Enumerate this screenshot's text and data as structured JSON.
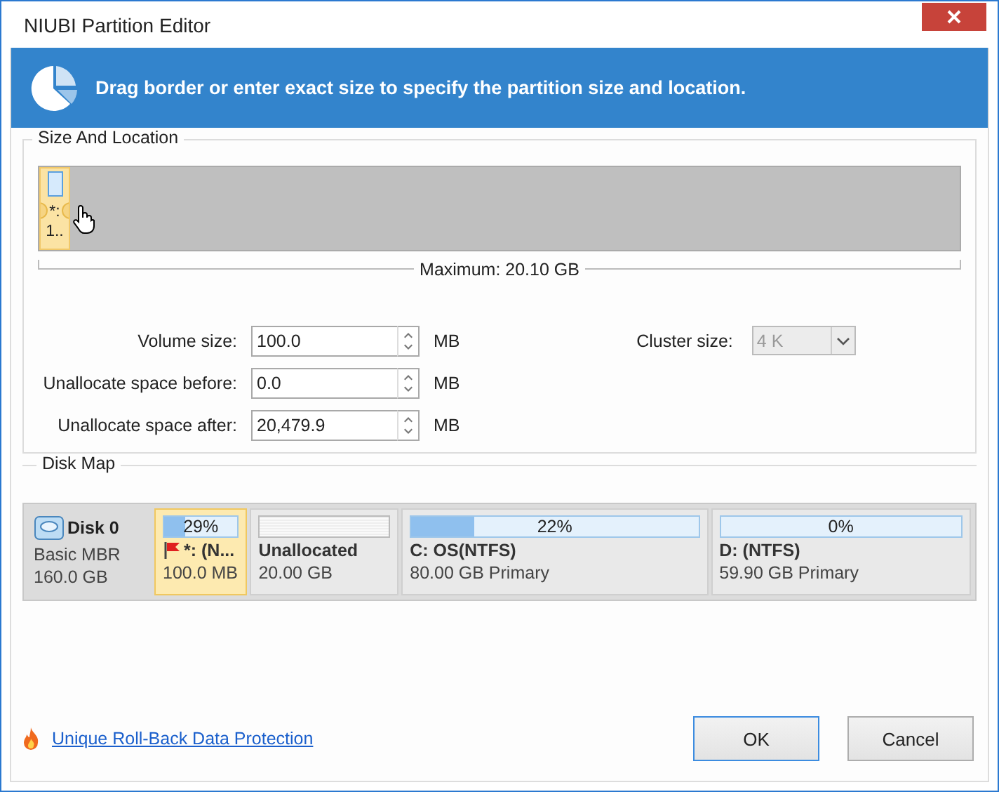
{
  "window": {
    "title": "NIUBI Partition Editor"
  },
  "banner": {
    "text": "Drag border or enter exact size to specify the partition size and location."
  },
  "size_location": {
    "legend": "Size And Location",
    "partition_block": {
      "label": "*:",
      "size": "1..",
      "selected": true
    },
    "maximum": "Maximum: 20.10 GB",
    "fields": [
      {
        "label": "Volume size:",
        "value": "100.0",
        "unit": "MB"
      },
      {
        "label": "Unallocate space before:",
        "value": "0.0",
        "unit": "MB"
      },
      {
        "label": "Unallocate space after:",
        "value": "20,479.9",
        "unit": "MB"
      }
    ],
    "cluster": {
      "label": "Cluster size:",
      "value": "4 K",
      "disabled": true
    }
  },
  "disk_map": {
    "legend": "Disk Map",
    "disk": {
      "name": "Disk 0",
      "type": "Basic MBR",
      "size": "160.0 GB"
    },
    "partitions": [
      {
        "kind": "volume",
        "usage": "29%",
        "level": 0.29,
        "name": "*: (N...",
        "size": "100.0 MB",
        "flagged": true,
        "selected": true
      },
      {
        "kind": "unallocated",
        "name": "Unallocated",
        "size": "20.00 GB",
        "selected": false
      },
      {
        "kind": "volume",
        "usage": "22%",
        "level": 0.22,
        "name": "C: OS(NTFS)",
        "size": "80.00 GB Primary",
        "flagged": false,
        "selected": false
      },
      {
        "kind": "volume",
        "usage": "0%",
        "level": 0,
        "name": "D: (NTFS)",
        "size": "59.90 GB Primary",
        "flagged": false,
        "selected": false
      }
    ]
  },
  "footer": {
    "link": "Unique Roll-Back Data Protection",
    "buttons": [
      {
        "label": "OK",
        "default": true
      },
      {
        "label": "Cancel",
        "default": false
      }
    ]
  }
}
